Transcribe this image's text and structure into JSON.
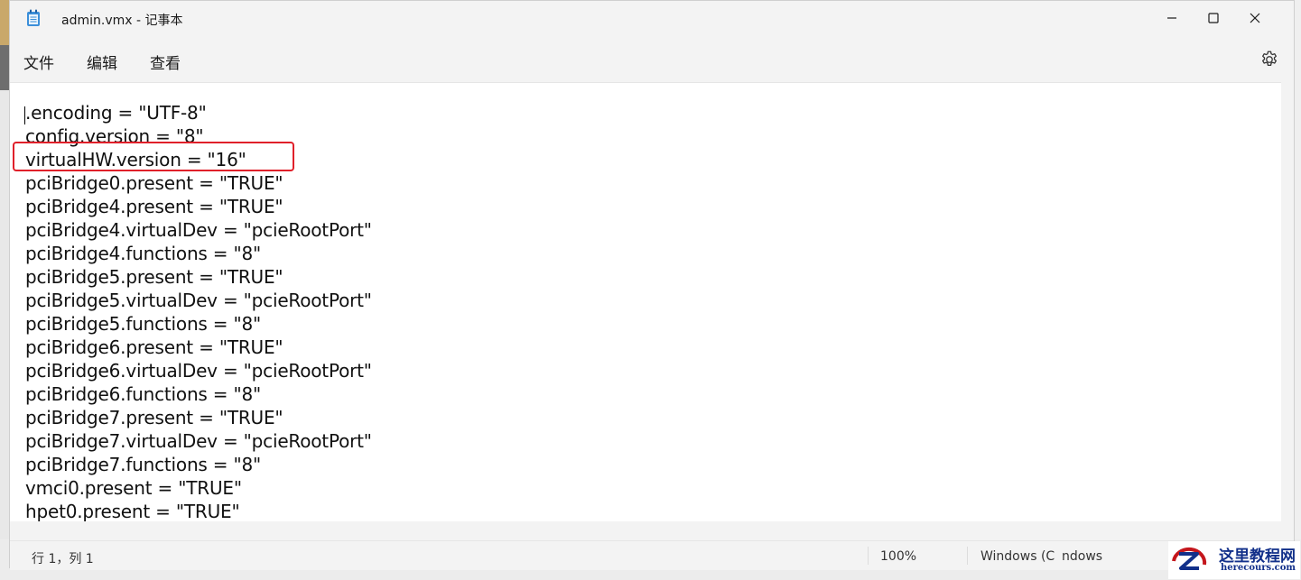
{
  "window": {
    "title": "admin.vmx - 记事本",
    "controls": [
      "minimize-icon",
      "maximize-icon",
      "close-icon"
    ]
  },
  "menu": {
    "file": "文件",
    "edit": "编辑",
    "view": "查看",
    "settings_icon": "gear-icon"
  },
  "editor": {
    "lines": [
      ".encoding = \"UTF-8\"",
      "config.version = \"8\"",
      "virtualHW.version = \"16\"",
      "pciBridge0.present = \"TRUE\"",
      "pciBridge4.present = \"TRUE\"",
      "pciBridge4.virtualDev = \"pcieRootPort\"",
      "pciBridge4.functions = \"8\"",
      "pciBridge5.present = \"TRUE\"",
      "pciBridge5.virtualDev = \"pcieRootPort\"",
      "pciBridge5.functions = \"8\"",
      "pciBridge6.present = \"TRUE\"",
      "pciBridge6.virtualDev = \"pcieRootPort\"",
      "pciBridge6.functions = \"8\"",
      "pciBridge7.present = \"TRUE\"",
      "pciBridge7.virtualDev = \"pcieRootPort\"",
      "pciBridge7.functions = \"8\"",
      "vmci0.present = \"TRUE\"",
      "hpet0.present = \"TRUE\""
    ],
    "highlight_color": "#e0202a"
  },
  "status": {
    "position": "行 1，列 1",
    "zoom": "100%",
    "line_ending": "Windows (C",
    "encoding": "ndows"
  },
  "watermark": {
    "title": "这里教程网",
    "url": "herecours.com"
  }
}
